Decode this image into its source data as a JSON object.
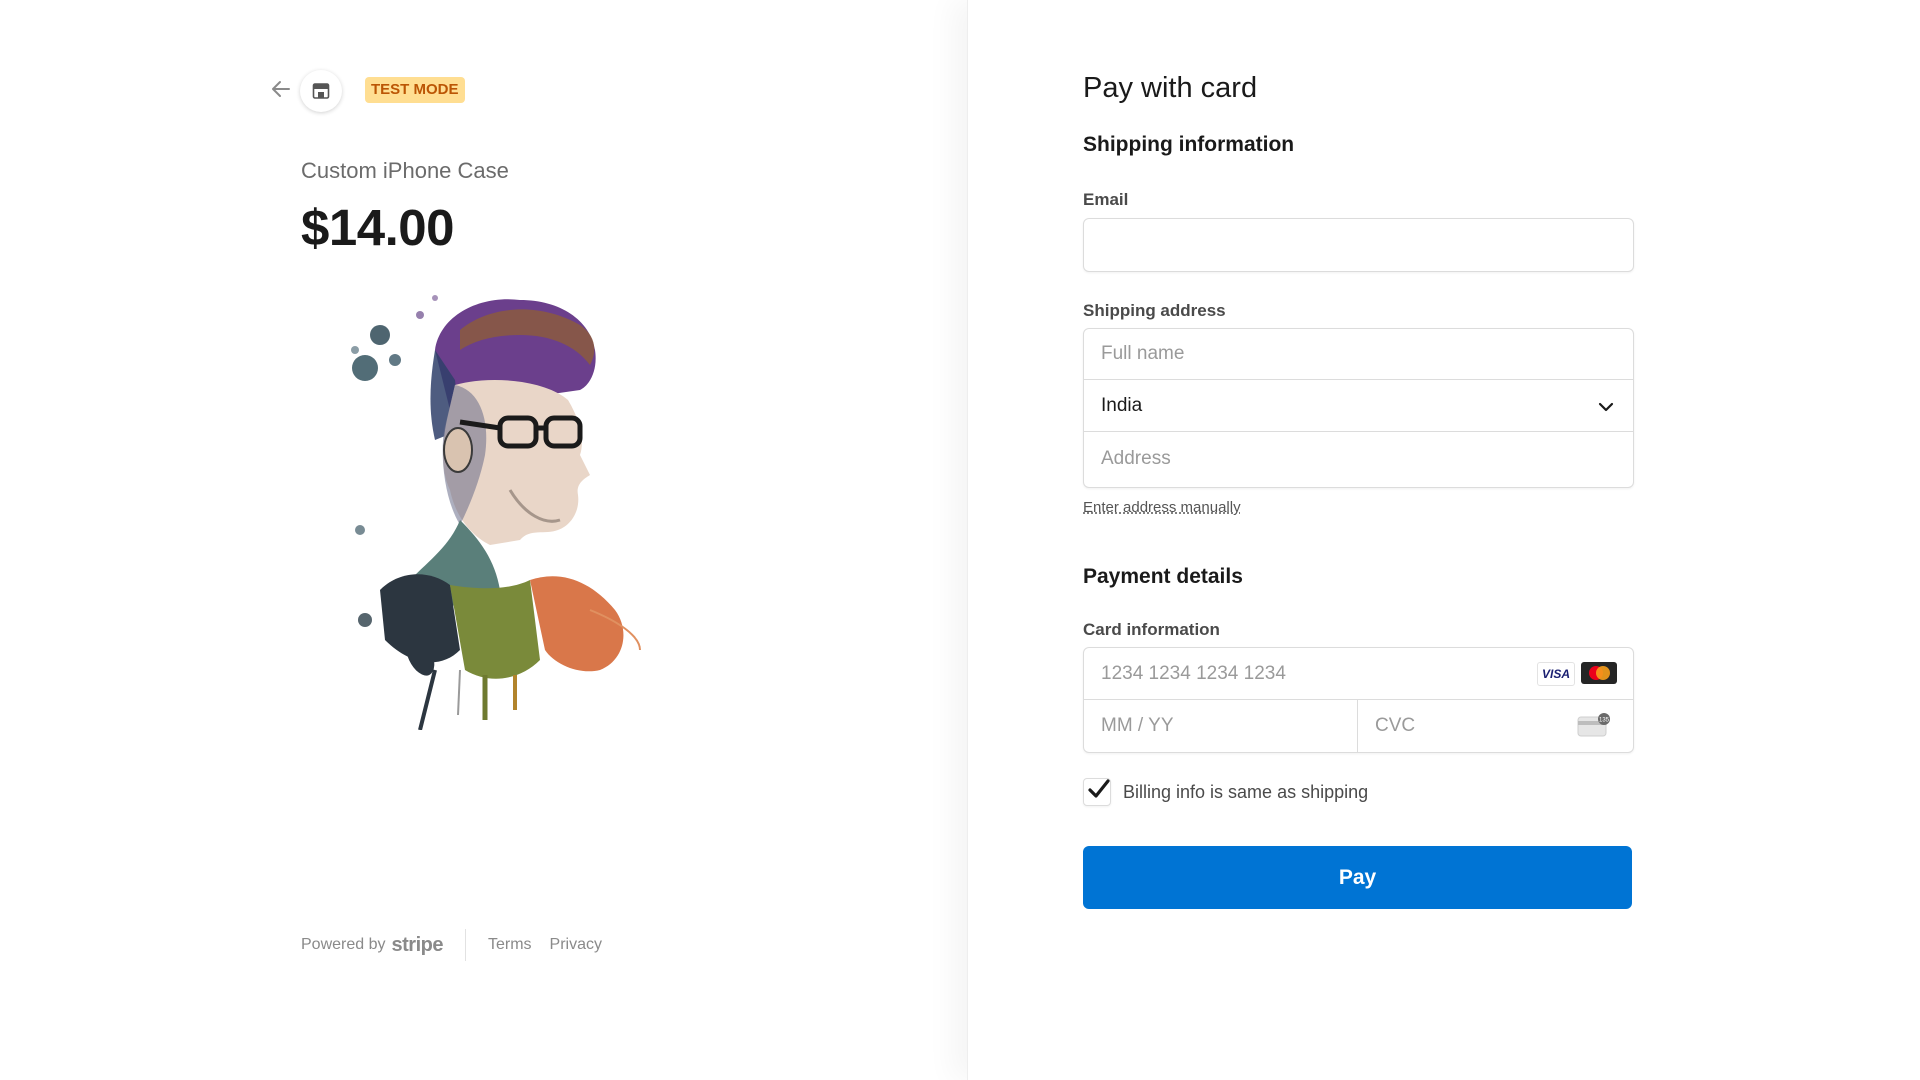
{
  "header": {
    "test_mode_label": "TEST MODE"
  },
  "product": {
    "name": "Custom iPhone Case",
    "price": "$14.00"
  },
  "footer": {
    "powered_by": "Powered by",
    "brand": "stripe",
    "terms": "Terms",
    "privacy": "Privacy"
  },
  "form": {
    "title": "Pay with card",
    "shipping_title": "Shipping information",
    "email_label": "Email",
    "email_value": "",
    "shipping_address_label": "Shipping address",
    "full_name_placeholder": "Full name",
    "country_value": "India",
    "address_placeholder": "Address",
    "manual_address_link": "Enter address manually",
    "payment_title": "Payment details",
    "card_label": "Card information",
    "card_number_placeholder": "1234 1234 1234 1234",
    "expiry_placeholder": "MM / YY",
    "cvc_placeholder": "CVC",
    "visa_label": "VISA",
    "billing_same_label": "Billing info is same as shipping",
    "billing_same_checked": true,
    "pay_button_label": "Pay"
  },
  "colors": {
    "accent": "#0074d4",
    "test_badge_bg": "#ffde92",
    "test_badge_text": "#bb5504"
  },
  "icons": {
    "back": "arrow-left-icon",
    "store": "store-icon",
    "chevron": "chevron-down-icon",
    "visa": "visa-icon",
    "mastercard": "mastercard-icon",
    "cvc": "cvc-card-icon",
    "check": "check-icon"
  }
}
